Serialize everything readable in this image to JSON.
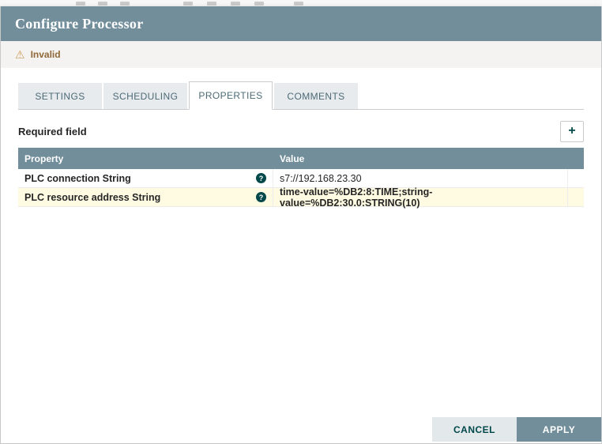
{
  "dialog": {
    "title": "Configure Processor",
    "status": "Invalid",
    "tabs": [
      {
        "label": "SETTINGS",
        "active": false
      },
      {
        "label": "SCHEDULING",
        "active": false
      },
      {
        "label": "PROPERTIES",
        "active": true
      },
      {
        "label": "COMMENTS",
        "active": false
      }
    ],
    "properties": {
      "required_label": "Required field",
      "columns": [
        "Property",
        "Value"
      ],
      "rows": [
        {
          "property": "PLC connection String",
          "value": "s7://192.168.23.30",
          "highlighted": false
        },
        {
          "property": "PLC resource address String",
          "value": "time-value=%DB2:8:TIME;string-value=%DB2:30.0:STRING(10)",
          "highlighted": true
        }
      ]
    },
    "footer": {
      "cancel": "CANCEL",
      "apply": "APPLY"
    }
  },
  "icons": {
    "warning": "⚠",
    "help": "?",
    "plus": "+"
  },
  "colors": {
    "header_bar": "#728e9b",
    "table_header": "#728e9b",
    "accent_teal": "#004849",
    "warning_icon": "#cf9f5d",
    "status_text": "#8f6838",
    "highlight_row": "#fffbe3",
    "apply_button": "#728e9b",
    "cancel_button": "#e3e8eb"
  }
}
